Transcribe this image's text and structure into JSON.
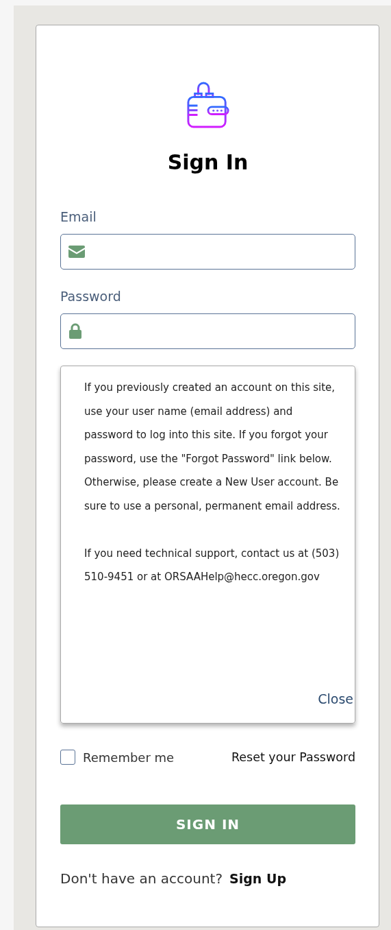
{
  "title": "Sign In",
  "fields": [
    {
      "label": "Email",
      "kind": "email"
    },
    {
      "label": "Password",
      "kind": "password"
    }
  ],
  "help_popup": {
    "paragraphs": [
      "If you previously created an account on this site, use your user name (email address) and password to log into this site. If you forgot your password, use the \"Forgot Password\" link below. Otherwise, please create a New User account. Be sure to use a personal, permanent email address.",
      "If you need technical support, contact us at (503) 510-9451 or at ORSAAHelp@hecc.oregon.gov"
    ],
    "close": "Close"
  },
  "remember": {
    "label": "Remember me",
    "checked": false
  },
  "reset_link": "Reset your Password",
  "submit": "SIGN IN",
  "signup": {
    "prompt": "Don't have an account?",
    "link": "Sign Up"
  }
}
